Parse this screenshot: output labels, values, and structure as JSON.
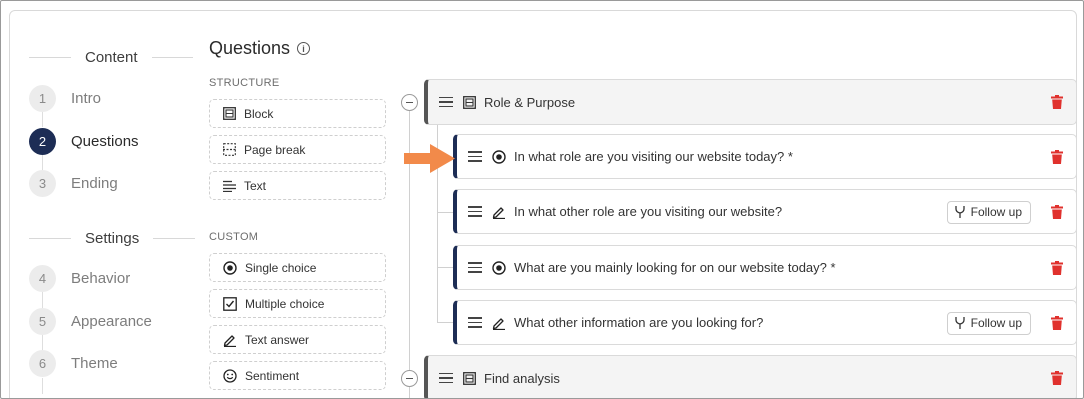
{
  "sidebar": {
    "content_heading": "Content",
    "settings_heading": "Settings",
    "content_steps": [
      {
        "num": "1",
        "label": "Intro"
      },
      {
        "num": "2",
        "label": "Questions"
      },
      {
        "num": "3",
        "label": "Ending"
      }
    ],
    "settings_steps": [
      {
        "num": "4",
        "label": "Behavior"
      },
      {
        "num": "5",
        "label": "Appearance"
      },
      {
        "num": "6",
        "label": "Theme"
      }
    ]
  },
  "palette": {
    "title": "Questions",
    "info_icon": "i",
    "structure_caption": "STRUCTURE",
    "custom_caption": "CUSTOM",
    "structure_items": [
      {
        "label": "Block",
        "icon": "block-icon"
      },
      {
        "label": "Page break",
        "icon": "page-break-icon"
      },
      {
        "label": "Text",
        "icon": "text-icon"
      }
    ],
    "custom_items": [
      {
        "label": "Single choice",
        "icon": "radio-icon"
      },
      {
        "label": "Multiple choice",
        "icon": "checkbox-icon"
      },
      {
        "label": "Text answer",
        "icon": "pencil-icon"
      },
      {
        "label": "Sentiment",
        "icon": "smiley-icon"
      }
    ]
  },
  "tree": {
    "blocks": [
      {
        "label": "Role & Purpose",
        "questions": [
          {
            "label": "In what role are you visiting our website today? *",
            "icon": "radio-icon",
            "follow_up": ""
          },
          {
            "label": "In what other role are you visiting our website?",
            "icon": "pencil-icon",
            "follow_up": "Follow up"
          },
          {
            "label": "What are you mainly looking for on our website today? *",
            "icon": "radio-icon",
            "follow_up": ""
          },
          {
            "label": "What other information are you looking for?",
            "icon": "pencil-icon",
            "follow_up": "Follow up"
          }
        ]
      },
      {
        "label": "Find analysis",
        "questions": []
      }
    ]
  },
  "colors": {
    "accent": "#1d2d55",
    "delete": "#e0312d",
    "arrow": "#f28a4a"
  }
}
